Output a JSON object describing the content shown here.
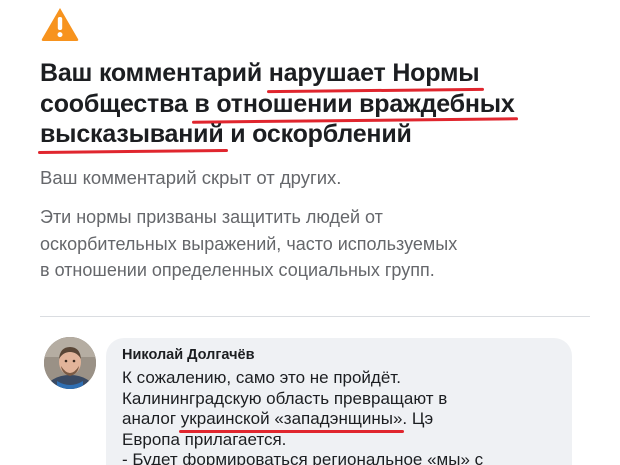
{
  "warning": {
    "icon": "warning-triangle-icon",
    "icon_color": "#f7931e"
  },
  "headline": {
    "line1_a": "Ваш комментарий ",
    "line1_b": "нарушает Нормы",
    "line2_a": "сообщества ",
    "line2_b": "в отношении враждебных",
    "line3_a": "высказываний",
    "line3_b": " и оскорблений"
  },
  "subtitle": "Ваш комментарий скрыт от других.",
  "explanation": {
    "lines": [
      "Эти нормы призваны защитить людей от",
      "оскорбительных выражений, часто используемых",
      "в отношении определенных социальных групп."
    ]
  },
  "comment": {
    "avatar": "avatar",
    "author": "Николай Долгачёв",
    "line1": "К сожалению, само это не пройдёт.",
    "line2": "Калининградскую область превращают в",
    "line3_a": "аналог ",
    "line3_b": "украинской «западэнщины»",
    "line3_c": ". Цэ",
    "line4": "Европа прилагается.",
    "line5": "- Будет формироваться региональное «мы» с"
  },
  "colors": {
    "highlight_underline": "#e0262e",
    "text_primary": "#1c1e21",
    "text_secondary": "#65676b",
    "bubble_bg": "#eff1f4"
  }
}
